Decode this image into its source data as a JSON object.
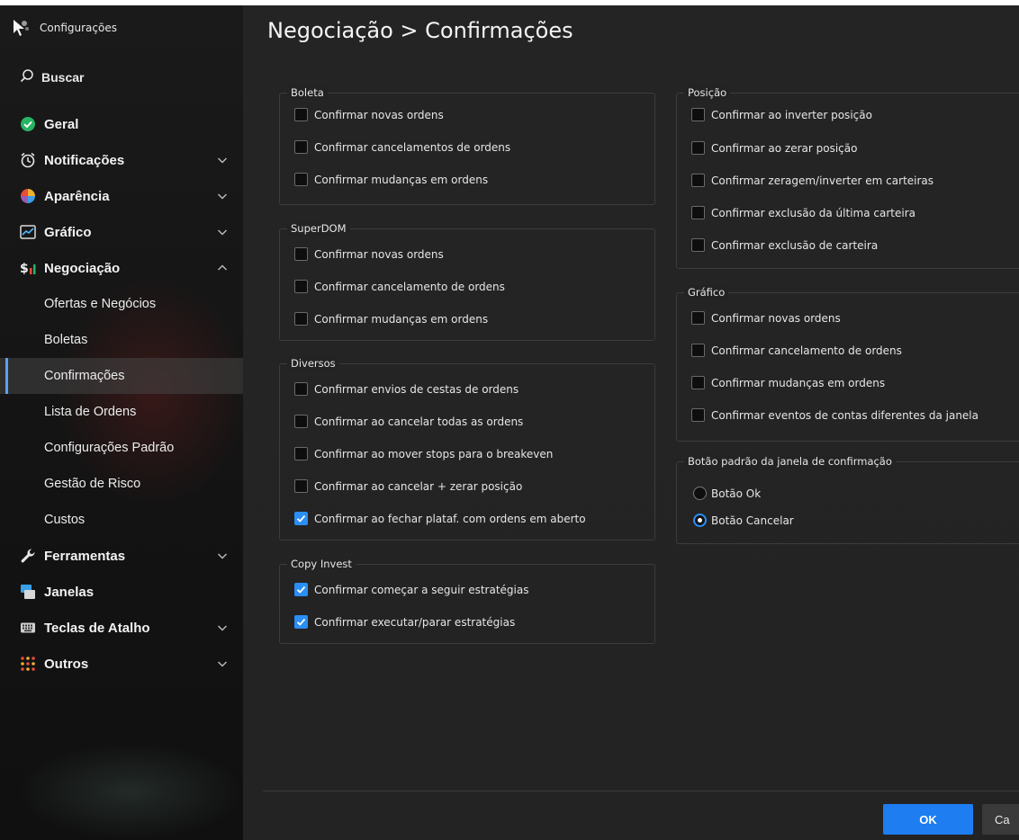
{
  "window": {
    "title": "Configurações"
  },
  "search": {
    "label": "Buscar"
  },
  "sidebar": {
    "items": [
      {
        "label": "Geral"
      },
      {
        "label": "Notificações"
      },
      {
        "label": "Aparência"
      },
      {
        "label": "Gráfico"
      },
      {
        "label": "Negociação"
      },
      {
        "label": "Ferramentas"
      },
      {
        "label": "Janelas"
      },
      {
        "label": "Teclas de Atalho"
      },
      {
        "label": "Outros"
      }
    ],
    "negociacao_sub": [
      {
        "label": "Ofertas e Negócios"
      },
      {
        "label": "Boletas"
      },
      {
        "label": "Confirmações"
      },
      {
        "label": "Lista de Ordens"
      },
      {
        "label": "Configurações Padrão"
      },
      {
        "label": "Gestão de Risco"
      },
      {
        "label": "Custos"
      }
    ]
  },
  "page": {
    "title": "Negociação > Confirmações"
  },
  "groups": {
    "boleta": {
      "title": "Boleta",
      "options": [
        {
          "label": "Confirmar novas ordens",
          "checked": false
        },
        {
          "label": "Confirmar cancelamentos de ordens",
          "checked": false
        },
        {
          "label": "Confirmar mudanças em ordens",
          "checked": false
        }
      ]
    },
    "superdom": {
      "title": "SuperDOM",
      "options": [
        {
          "label": "Confirmar novas ordens",
          "checked": false
        },
        {
          "label": "Confirmar cancelamento de ordens",
          "checked": false
        },
        {
          "label": "Confirmar mudanças em ordens",
          "checked": false
        }
      ]
    },
    "diversos": {
      "title": "Diversos",
      "options": [
        {
          "label": "Confirmar envios de cestas de ordens",
          "checked": false
        },
        {
          "label": "Confirmar ao cancelar todas as ordens",
          "checked": false
        },
        {
          "label": "Confirmar ao mover stops para o breakeven",
          "checked": false
        },
        {
          "label": "Confirmar ao cancelar + zerar posição",
          "checked": false
        },
        {
          "label": "Confirmar ao fechar plataf. com ordens em aberto",
          "checked": true
        }
      ]
    },
    "copyinvest": {
      "title": "Copy Invest",
      "options": [
        {
          "label": "Confirmar começar a seguir estratégias",
          "checked": true
        },
        {
          "label": "Confirmar executar/parar estratégias",
          "checked": true
        }
      ]
    },
    "posicao": {
      "title": "Posição",
      "options": [
        {
          "label": "Confirmar ao inverter posição",
          "checked": false
        },
        {
          "label": "Confirmar ao zerar posição",
          "checked": false
        },
        {
          "label": "Confirmar zeragem/inverter em carteiras",
          "checked": false
        },
        {
          "label": "Confirmar exclusão da última carteira",
          "checked": false
        },
        {
          "label": "Confirmar exclusão de carteira",
          "checked": false
        }
      ]
    },
    "grafico": {
      "title": "Gráfico",
      "options": [
        {
          "label": "Confirmar novas ordens",
          "checked": false
        },
        {
          "label": "Confirmar cancelamento de ordens",
          "checked": false
        },
        {
          "label": "Confirmar mudanças em ordens",
          "checked": false
        },
        {
          "label": "Confirmar eventos de contas diferentes da janela",
          "checked": false
        }
      ]
    },
    "botao_padrao": {
      "title": "Botão padrão da janela de confirmação",
      "options": [
        {
          "label": "Botão Ok",
          "selected": false
        },
        {
          "label": "Botão Cancelar",
          "selected": true
        }
      ]
    }
  },
  "footer": {
    "ok_label": "OK",
    "cancel_label": "Ca"
  },
  "colors": {
    "accent": "#2b8ef5",
    "ok_button": "#1e7df0"
  }
}
